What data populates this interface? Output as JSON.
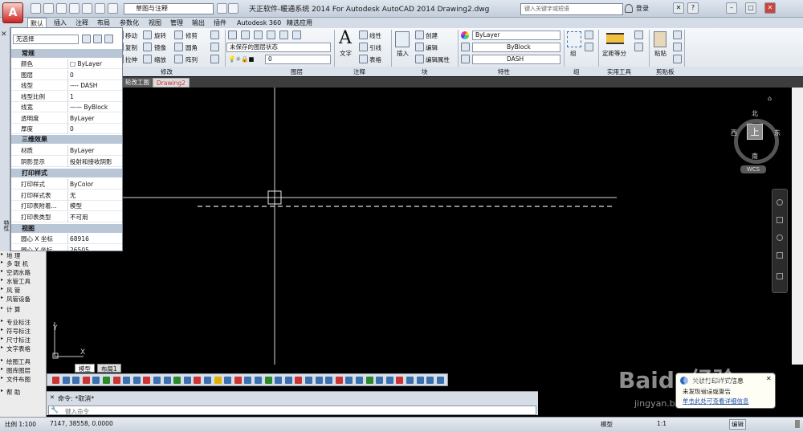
{
  "titlebar": {
    "app_letter": "A",
    "workspace": "草图与注释",
    "title": "天正软件-暖通系统 2014 For Autodesk AutoCAD 2014      Drawing2.dwg",
    "search_placeholder": "键入关键字或短语",
    "login": "登录"
  },
  "tabs": [
    "默认",
    "插入",
    "注释",
    "布局",
    "参数化",
    "视图",
    "管理",
    "输出",
    "插件",
    "Autodesk 360",
    "精选应用"
  ],
  "ribbon": {
    "modify": {
      "move": "移动",
      "rotate": "旋转",
      "trim": "修剪",
      "copy": "复制",
      "mirror": "镜像",
      "fillet": "圆角",
      "stretch": "拉伸",
      "scale": "缩放",
      "array": "阵列",
      "label": "修改"
    },
    "layers": {
      "layer_state": "未保存的图层状态",
      "current_layer": "0",
      "label": "图层"
    },
    "annotation": {
      "text": "文字",
      "linear": "线性",
      "leader": "引线",
      "table": "表格",
      "label": "注释"
    },
    "block": {
      "insert": "插入",
      "create": "创建",
      "edit": "编辑",
      "edit_attr": "编辑属性",
      "label": "块"
    },
    "properties": {
      "color": "ByLayer",
      "lineweight": "ByBlock",
      "linetype": "DASH",
      "label": "特性"
    },
    "groups": {
      "group": "组",
      "label": "组"
    },
    "utilities": {
      "measure": "定距等分",
      "label": "实用工具"
    },
    "clipboard": {
      "paste": "粘贴",
      "label": "剪贴板"
    }
  },
  "properties_panel": {
    "selection": "无选择",
    "sections": {
      "general": "常规",
      "3d": "三维效果",
      "plot": "打印样式",
      "view": "视图"
    },
    "general": [
      [
        "颜色",
        "□ ByLayer"
      ],
      [
        "图层",
        "0"
      ],
      [
        "线型",
        "---- DASH"
      ],
      [
        "线型比例",
        "1"
      ],
      [
        "线宽",
        "—— ByBlock"
      ],
      [
        "透明度",
        "ByLayer"
      ],
      [
        "厚度",
        "0"
      ]
    ],
    "effects": [
      [
        "材质",
        "ByLayer"
      ],
      [
        "阴影显示",
        "投射和接收阴影"
      ]
    ],
    "plot": [
      [
        "打印样式",
        "ByColor"
      ],
      [
        "打印样式表",
        "无"
      ],
      [
        "打印表附着...",
        "模型"
      ],
      [
        "打印表类型",
        "不可用"
      ]
    ],
    "view": [
      [
        "圆心 X 坐标",
        "68916"
      ],
      [
        "圆心 Y 坐标",
        "26505"
      ]
    ]
  },
  "side_label": "特性",
  "doc_tabs": [
    "轮改工图",
    "Drawing2"
  ],
  "left_menu": [
    "地  理",
    "多 联 机",
    "空调水路",
    "水管工具",
    "风    管",
    "风管设备",
    "计    算",
    "专业标注",
    "符号标注",
    "尺寸标注",
    "文字表格",
    "绘图工具",
    "图库图层",
    "文件布图",
    "帮    助"
  ],
  "compass": {
    "north": "北",
    "south": "南",
    "east": "东",
    "west": "西",
    "top": "上",
    "wcs": "WCS"
  },
  "model_tabs": [
    "模型",
    "布局1"
  ],
  "command": {
    "history": "命令: *取消*",
    "placeholder": "键入命令"
  },
  "status": {
    "scale": "比例 1:100",
    "coords": "7147, 38558, 0.0000",
    "model": "模型",
    "annoscale": "1:1",
    "mode": "编辑"
  },
  "notify": {
    "title": "关联打印样式信息",
    "line1": "未发现错误或警告",
    "link": "单击此处可查看详细信息"
  },
  "watermark": {
    "brand": "Baidu经验",
    "url": "jingyan.baidu.com"
  }
}
